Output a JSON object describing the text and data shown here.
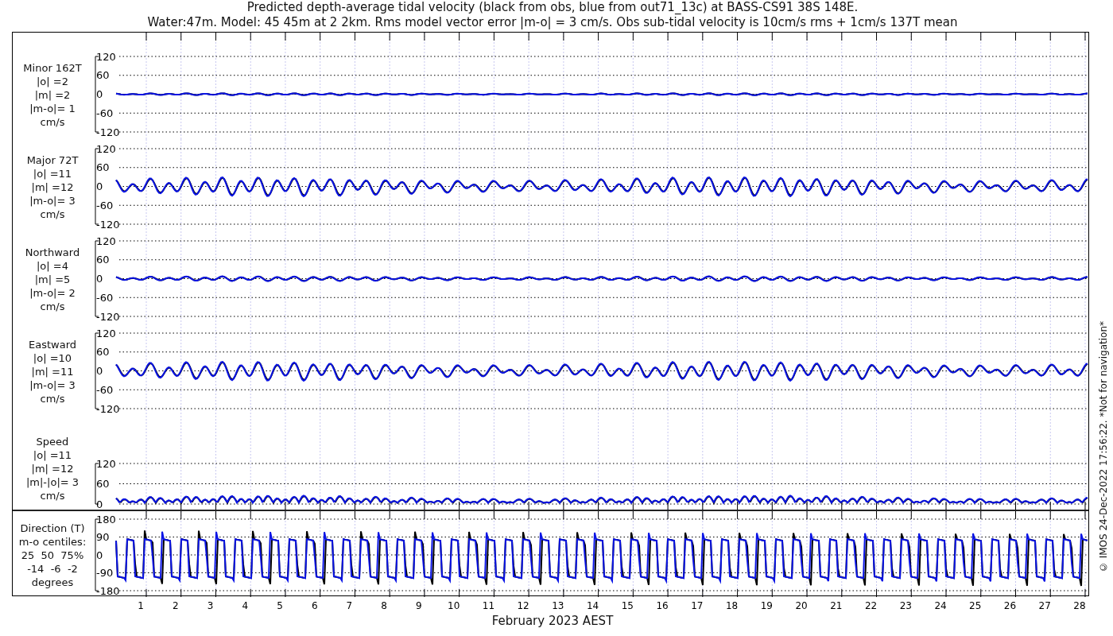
{
  "title": [
    "Predicted depth-average tidal velocity (black from obs, blue from out71_13c) at BASS-CS91 38S 148E.",
    "Water:47m. Model: 45 45m at 2 2km. Rms model vector error |m-o| = 3 cm/s. Obs sub-tidal velocity is 10cm/s rms + 1cm/s 137T mean"
  ],
  "panels": [
    {
      "kind": "velocity",
      "label_lines": [
        "Minor 162T",
        "|o| =2",
        "|m| =2",
        "|m-o|= 1",
        "cm/s"
      ],
      "yticks": [
        "120",
        "60",
        "0",
        "-60",
        "-120"
      ]
    },
    {
      "kind": "velocity",
      "label_lines": [
        "Major 72T",
        "|o| =11",
        "|m| =12",
        "|m-o|= 3",
        "cm/s"
      ],
      "yticks": [
        "120",
        "60",
        "0",
        "-60",
        "-120"
      ]
    },
    {
      "kind": "velocity",
      "label_lines": [
        "Northward",
        "|o| =4",
        "|m| =5",
        "|m-o|= 2",
        "cm/s"
      ],
      "yticks": [
        "120",
        "60",
        "0",
        "-60",
        "-120"
      ]
    },
    {
      "kind": "velocity",
      "label_lines": [
        "Eastward",
        "|o| =10",
        "|m| =11",
        "|m-o|= 3",
        "cm/s"
      ],
      "yticks": [
        "120",
        "60",
        "0",
        "-60",
        "-120"
      ]
    },
    {
      "kind": "speed",
      "label_lines": [
        "Speed",
        "|o| =11",
        "|m| =12",
        "|m|-|o|= 3",
        "cm/s"
      ],
      "yticks": [
        "120",
        "60",
        "0"
      ]
    },
    {
      "kind": "direction",
      "label_lines": [
        "Direction (T)",
        "m-o centiles:",
        "25  50  75%",
        "-14  -6  -2",
        "degrees"
      ],
      "yticks": [
        "180",
        "90",
        "0",
        "-90",
        "-180"
      ]
    }
  ],
  "xaxis": {
    "ticks": [
      "1",
      "2",
      "3",
      "4",
      "5",
      "6",
      "7",
      "8",
      "9",
      "10",
      "11",
      "12",
      "13",
      "14",
      "15",
      "16",
      "17",
      "18",
      "19",
      "20",
      "21",
      "22",
      "23",
      "24",
      "25",
      "26",
      "27",
      "28"
    ],
    "label": "February 2023 AEST"
  },
  "footer": "© IMOS 24-Dec-2022 17:56:22.  *Not for navigation*"
}
